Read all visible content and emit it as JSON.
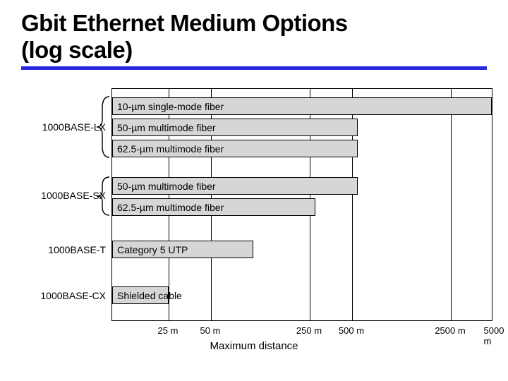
{
  "title_line1": "Gbit Ethernet Medium Options",
  "title_line2": "(log scale)",
  "x_axis_label": "Maximum distance",
  "ticks": {
    "t25": "25 m",
    "t50": "50 m",
    "t250": "250 m",
    "t500": "500 m",
    "t2500": "2500 m",
    "t5000": "5000 m"
  },
  "groups": {
    "lx": "1000BASE-LX",
    "sx": "1000BASE-SX",
    "t": "1000BASE-T",
    "cx": "1000BASE-CX"
  },
  "bars": {
    "lx_10": "10-µm single-mode fiber",
    "lx_50": "50-µm multimode fiber",
    "lx_625": "62.5-µm multimode fiber",
    "sx_50": "50-µm multimode fiber",
    "sx_625": "62.5-µm multimode fiber",
    "t_cat5": "Category 5 UTP",
    "cx_stp": "Shielded cable"
  },
  "chart_data": {
    "type": "bar",
    "orientation": "horizontal",
    "title": "Gbit Ethernet Medium Options (log scale)",
    "xlabel": "Maximum distance",
    "xscale": "log",
    "xticks": [
      25,
      50,
      250,
      500,
      2500,
      5000
    ],
    "xtick_labels": [
      "25 m",
      "50 m",
      "250 m",
      "500 m",
      "2500 m",
      "5000 m"
    ],
    "xlim": [
      10,
      5000
    ],
    "series": [
      {
        "group": "1000BASE-LX",
        "name": "10-µm single-mode fiber",
        "value": 5000
      },
      {
        "group": "1000BASE-LX",
        "name": "50-µm multimode fiber",
        "value": 550
      },
      {
        "group": "1000BASE-LX",
        "name": "62.5-µm multimode fiber",
        "value": 550
      },
      {
        "group": "1000BASE-SX",
        "name": "50-µm multimode fiber",
        "value": 550
      },
      {
        "group": "1000BASE-SX",
        "name": "62.5-µm multimode fiber",
        "value": 275
      },
      {
        "group": "1000BASE-T",
        "name": "Category 5 UTP",
        "value": 100
      },
      {
        "group": "1000BASE-CX",
        "name": "Shielded cable",
        "value": 25
      }
    ]
  }
}
